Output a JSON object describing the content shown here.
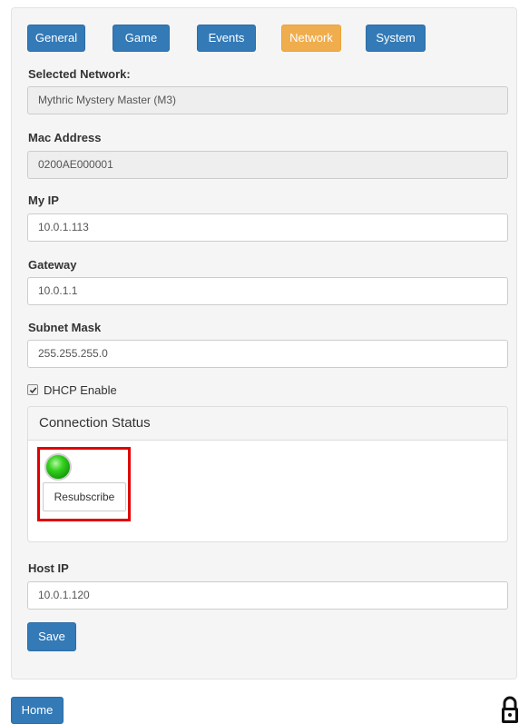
{
  "tabs": [
    {
      "label": "General",
      "active": false
    },
    {
      "label": "Game",
      "active": false
    },
    {
      "label": "Events",
      "active": false
    },
    {
      "label": "Network",
      "active": true
    },
    {
      "label": "System",
      "active": false
    }
  ],
  "fields": {
    "selected_network": {
      "label": "Selected Network:",
      "value": "Mythric Mystery Master (M3)"
    },
    "mac_address": {
      "label": "Mac Address",
      "value": "0200AE000001"
    },
    "my_ip": {
      "label": "My IP",
      "value": "10.0.1.113"
    },
    "gateway": {
      "label": "Gateway",
      "value": "10.0.1.1"
    },
    "subnet_mask": {
      "label": "Subnet Mask",
      "value": "255.255.255.0"
    },
    "host_ip": {
      "label": "Host IP",
      "value": "10.0.1.120"
    }
  },
  "dhcp": {
    "label": "DHCP Enable",
    "checked": true
  },
  "connection_status": {
    "title": "Connection Status",
    "indicator_color": "#2ecc1f",
    "resubscribe_label": "Resubscribe"
  },
  "save_label": "Save",
  "home_label": "Home",
  "colors": {
    "primary": "#337ab7",
    "active_tab": "#f0ad4e",
    "highlight_border": "#e00000"
  },
  "icons": {
    "lock": "lock-icon",
    "check": "checkmark-icon"
  }
}
